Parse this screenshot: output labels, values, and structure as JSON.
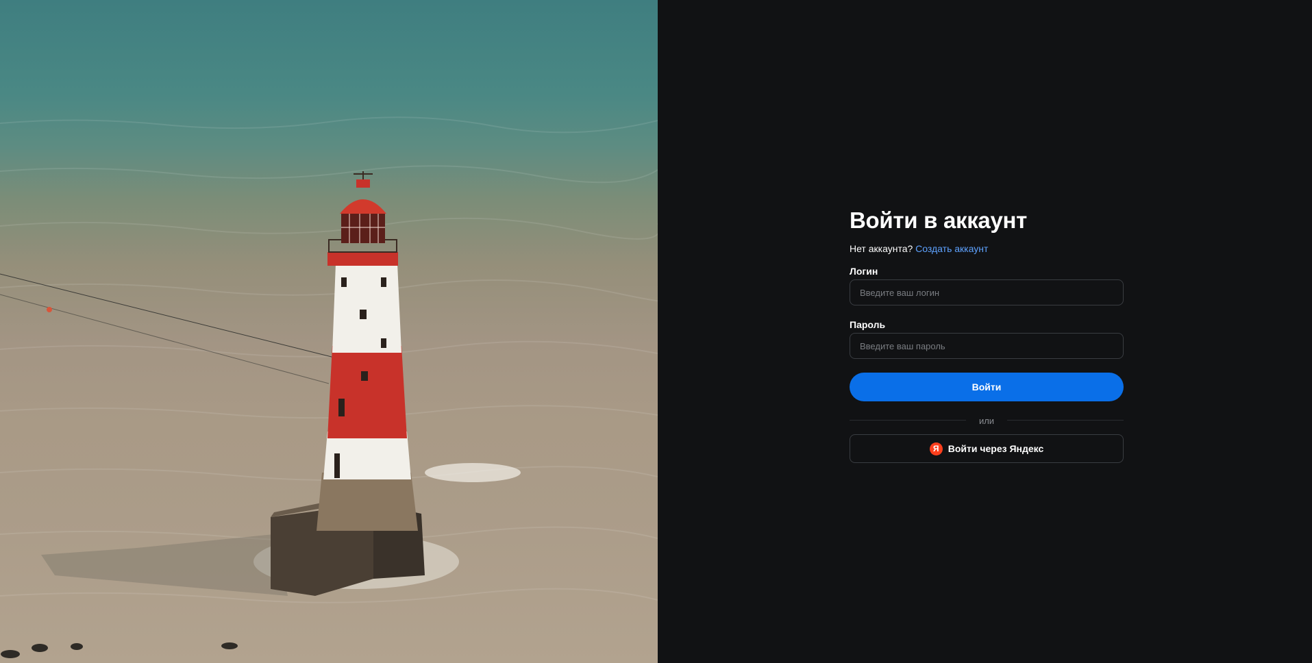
{
  "hero": {
    "image_name": "lighthouse-photo",
    "colors": {
      "sea_top": "#3f7e80",
      "sea_bottom": "#b2a38f",
      "tower_red": "#c8322a",
      "tower_white": "#f2f0ea"
    }
  },
  "login": {
    "title": "Войти в аккаунт",
    "no_account_text": "Нет аккаунта?",
    "create_account_link": "Создать аккаунт",
    "login_label": "Логин",
    "login_placeholder": "Введите ваш логин",
    "login_value": "",
    "password_label": "Пароль",
    "password_placeholder": "Введите ваш пароль",
    "password_value": "",
    "submit_label": "Войти",
    "divider_text": "или",
    "yandex_icon_letter": "Я",
    "yandex_button_label": "Войти через Яндекс"
  },
  "colors": {
    "background": "#111214",
    "accent": "#0a6fe8",
    "link": "#5ea2ff",
    "input_border": "#3a3d42",
    "yandex_red": "#fc3f1d"
  }
}
